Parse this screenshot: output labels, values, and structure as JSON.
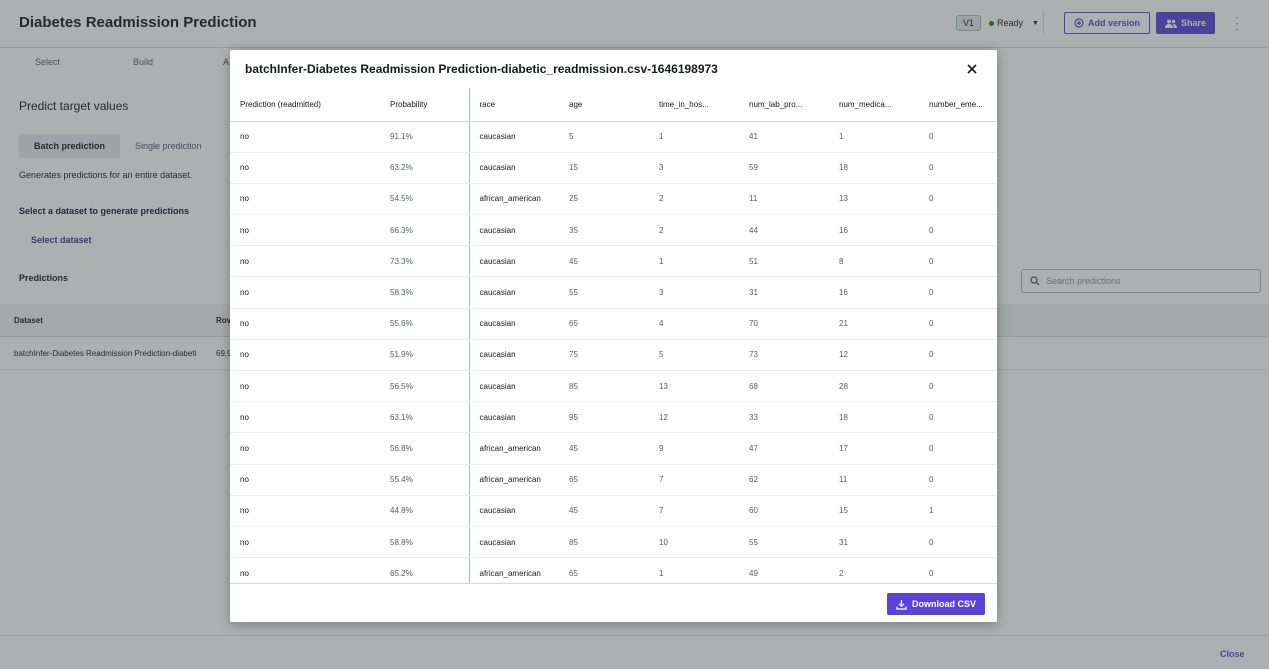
{
  "app": {
    "title": "Diabetes Readmission Prediction",
    "version": "V1",
    "status": "Ready",
    "add_version_label": "Add version",
    "share_label": "Share"
  },
  "tabs": [
    "Select",
    "Build",
    "A"
  ],
  "predict": {
    "title": "Predict target values",
    "batch_label": "Batch prediction",
    "single_label": "Single prediction",
    "description": "Generates predictions for an entire dataset.",
    "select_title": "Select a dataset to generate predictions",
    "select_link": "Select dataset",
    "predictions_title": "Predictions",
    "search_placeholder": "Search predictions"
  },
  "bg_table": {
    "headers": [
      "Dataset",
      "Rov"
    ],
    "row": [
      "batchInfer-Diabetes Readmission Prediction-diabeti",
      "69,9"
    ]
  },
  "footer": {
    "close_label": "Close"
  },
  "modal": {
    "title": "batchInfer-Diabetes Readmission Prediction-diabetic_readmission.csv-1646198973",
    "download_label": "Download CSV",
    "columns": [
      "Prediction (readmitted)",
      "Probability",
      "race",
      "age",
      "time_in_hos...",
      "num_lab_pro...",
      "num_medica...",
      "number_eme..."
    ],
    "rows": [
      [
        "no",
        "91.1%",
        "caucasian",
        "5",
        "1",
        "41",
        "1",
        "0"
      ],
      [
        "no",
        "63.2%",
        "caucasian",
        "15",
        "3",
        "59",
        "18",
        "0"
      ],
      [
        "no",
        "54.5%",
        "african_american",
        "25",
        "2",
        "11",
        "13",
        "0"
      ],
      [
        "no",
        "66.3%",
        "caucasian",
        "35",
        "2",
        "44",
        "16",
        "0"
      ],
      [
        "no",
        "73.3%",
        "caucasian",
        "45",
        "1",
        "51",
        "8",
        "0"
      ],
      [
        "no",
        "58.3%",
        "caucasian",
        "55",
        "3",
        "31",
        "16",
        "0"
      ],
      [
        "no",
        "55.6%",
        "caucasian",
        "65",
        "4",
        "70",
        "21",
        "0"
      ],
      [
        "no",
        "51.9%",
        "caucasian",
        "75",
        "5",
        "73",
        "12",
        "0"
      ],
      [
        "no",
        "56.5%",
        "caucasian",
        "85",
        "13",
        "68",
        "28",
        "0"
      ],
      [
        "no",
        "63.1%",
        "caucasian",
        "95",
        "12",
        "33",
        "18",
        "0"
      ],
      [
        "no",
        "56.8%",
        "african_american",
        "45",
        "9",
        "47",
        "17",
        "0"
      ],
      [
        "no",
        "55.4%",
        "african_american",
        "65",
        "7",
        "62",
        "11",
        "0"
      ],
      [
        "no",
        "44.8%",
        "caucasian",
        "45",
        "7",
        "60",
        "15",
        "1"
      ],
      [
        "no",
        "58.8%",
        "caucasian",
        "85",
        "10",
        "55",
        "31",
        "0"
      ],
      [
        "no",
        "65.2%",
        "african_american",
        "65",
        "1",
        "49",
        "2",
        "0"
      ]
    ]
  },
  "colors": {
    "accent": "#5a43d6",
    "status_ready": "#1d8102"
  }
}
